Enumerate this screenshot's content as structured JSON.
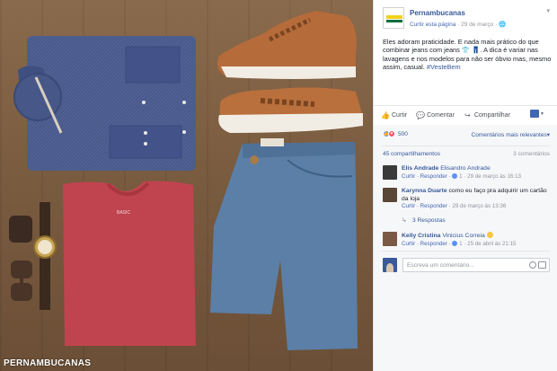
{
  "photo": {
    "watermark": "PERNAMBUCANAS",
    "tshirt_brand": "BASIC",
    "items": [
      "denim-shirt",
      "leather-sneakers",
      "red-tshirt",
      "jeans",
      "watch",
      "sunglasses"
    ]
  },
  "post": {
    "page_name": "Pernambucanas",
    "follow_label": "Curtir esta página",
    "separator": "·",
    "date": "29 de março",
    "globe_icon": "globe-icon",
    "text": "Eles adoram praticidade. E nada mais prático do que combinar jeans com jeans 👕 👖. A dica é variar nas lavagens e nos modelos para não ser óbvio mas, mesmo assim, casual.",
    "hashtag": "#VesteBem"
  },
  "actions": {
    "like": "Curtir",
    "comment": "Comentar",
    "share": "Compartilhar"
  },
  "stats": {
    "reaction_count": "500",
    "sort_label": "Comentários mais relevantes",
    "shares": "45 compartilhamentos",
    "comments": "3 comentários"
  },
  "comments": [
    {
      "author": "Elis Andrade",
      "mention": "Elisandro Andrade",
      "text": "",
      "reply": "Curtir · Responder ·",
      "likes": "1",
      "time": "· 29 de março às 16:13",
      "avatar_color": "#3a3a3a"
    },
    {
      "author": "Karynna Duarte",
      "mention": "",
      "text": "como eu faço pra adquirir um cartão da loja",
      "reply": "Curtir · Responder ·",
      "likes": "",
      "time": "29 de março às 13:36",
      "avatar_color": "#5a4636"
    },
    {
      "author": "Kelly Cristina",
      "mention": "Vinicius Correia",
      "text": "",
      "reply": "Curtir · Responder ·",
      "likes": "1",
      "time": "· 25 de abril às 21:15",
      "avatar_color": "#7a5a44"
    }
  ],
  "replies_label": "3 Respostas",
  "composer": {
    "placeholder": "Escreva um comentário..."
  },
  "colors": {
    "facebook_blue": "#4267b2",
    "link": "#365899",
    "brand_yellow": "#f4d11d",
    "brand_green": "#0d6e3e"
  }
}
